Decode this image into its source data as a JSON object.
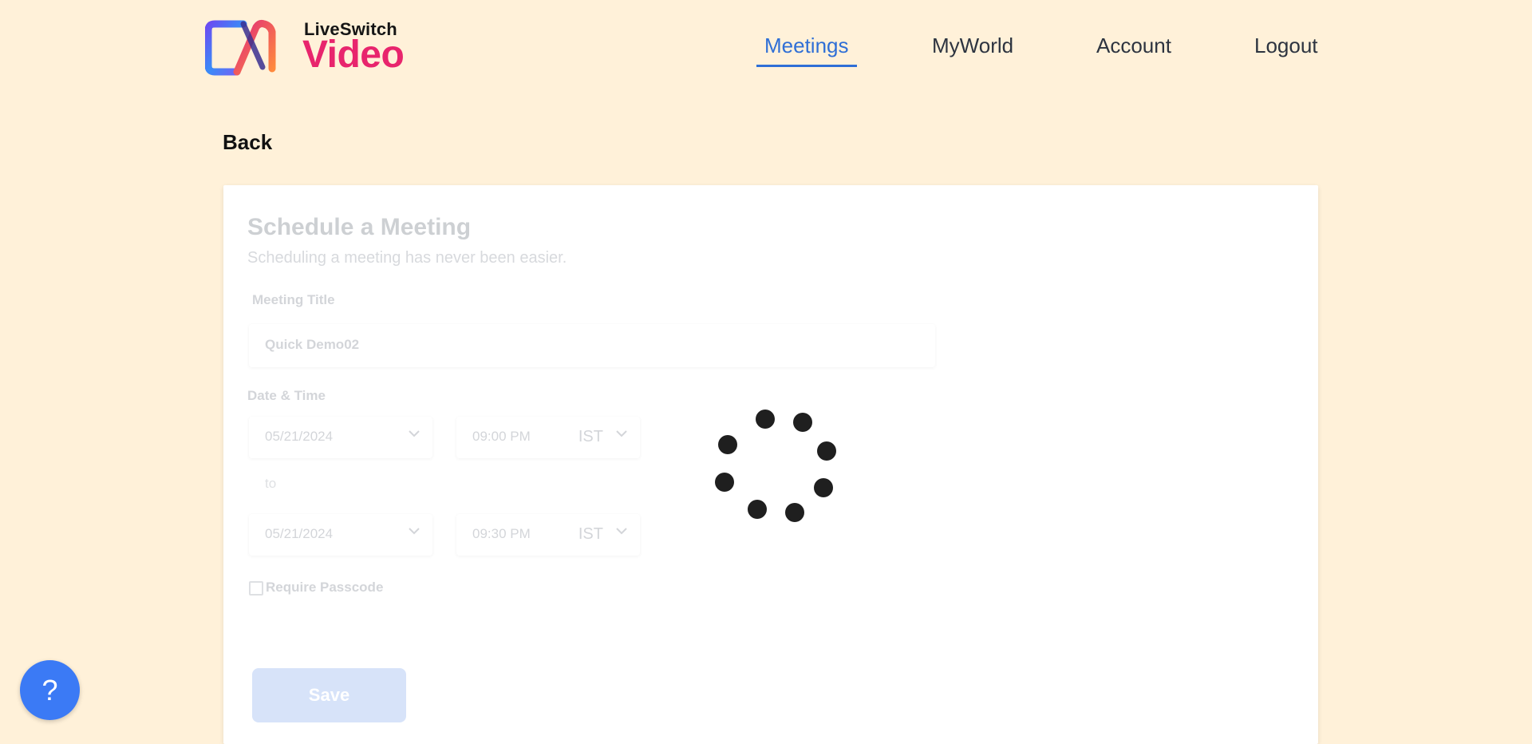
{
  "brand": {
    "top": "LiveSwitch",
    "main": "Video",
    "logo_icon": "liveswitch-logo-icon"
  },
  "nav": {
    "items": [
      {
        "label": "Meetings",
        "active": true
      },
      {
        "label": "MyWorld",
        "active": false
      },
      {
        "label": "Account",
        "active": false
      },
      {
        "label": "Logout",
        "active": false
      }
    ]
  },
  "back_label": "Back",
  "form": {
    "title": "Schedule a Meeting",
    "subtitle": "Scheduling a meeting has never been easier.",
    "meeting_title_label": "Meeting Title",
    "meeting_title_value": "Quick Demo02",
    "date_time_label": "Date & Time",
    "start_date": "05/21/2024",
    "start_time": "09:00 PM",
    "start_tz": "IST",
    "to_label": "to",
    "end_date": "05/21/2024",
    "end_time": "09:30 PM",
    "end_tz": "IST",
    "passcode_label": "Require Passcode",
    "passcode_checked": false,
    "save_label": "Save"
  },
  "loading": true,
  "help_label": "?",
  "colors": {
    "background": "#fff1d9",
    "accent": "#2f6fd6",
    "brand_pink": "#e8256d",
    "help_button": "#3b7af5"
  }
}
